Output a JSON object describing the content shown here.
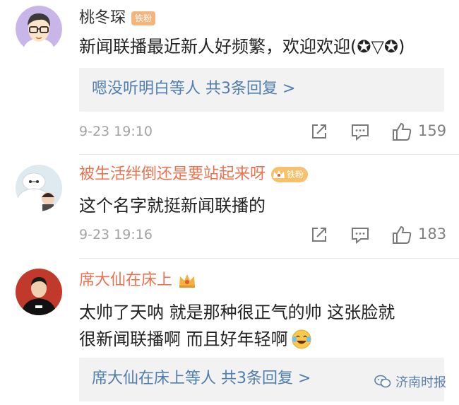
{
  "comments": [
    {
      "username": "桃冬琛",
      "badge": "铁粉",
      "text_lines": [
        "新闻联播最近新人好频繁，欢迎欢迎(✪▽✪)"
      ],
      "replies": "嗯没听明白等人 共3条回复 >",
      "time": "9-23 19:10",
      "likes": "159"
    },
    {
      "username": "被生活绊倒还是要站起来呀",
      "badge": "铁粉",
      "text_lines": [
        "这个名字就挺新闻联播的"
      ],
      "time": "9-23 19:16",
      "likes": "183"
    },
    {
      "username": "席大仙在床上",
      "text_lines": [
        "太帅了天呐 就是那种很正气的帅 这张脸就",
        "很新闻联播啊 而且好年轻啊"
      ],
      "replies": "席大仙在床上等人 共3条回复 >"
    }
  ],
  "watermark": "济南时报",
  "colors": {
    "link": "#507daf",
    "orange_name": "#eb7350",
    "meta_gray": "#a3a3a3"
  },
  "icons": [
    "share-icon",
    "comment-icon",
    "like-icon",
    "crown-icon",
    "laugh-cry-emoji",
    "wechat-logo-icon"
  ]
}
